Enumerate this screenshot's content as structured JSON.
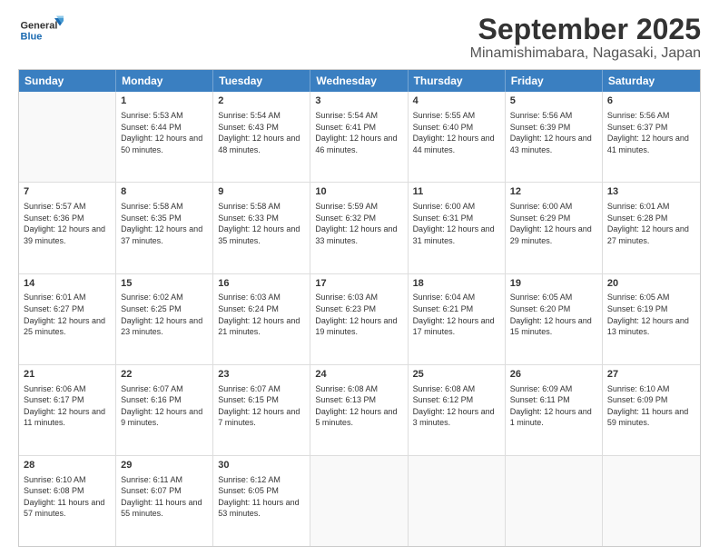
{
  "logo": {
    "general": "General",
    "blue": "Blue"
  },
  "title": "September 2025",
  "subtitle": "Minamishimabara, Nagasaki, Japan",
  "days": [
    "Sunday",
    "Monday",
    "Tuesday",
    "Wednesday",
    "Thursday",
    "Friday",
    "Saturday"
  ],
  "rows": [
    [
      {
        "day": "",
        "empty": true
      },
      {
        "day": "1",
        "sunrise": "Sunrise: 5:53 AM",
        "sunset": "Sunset: 6:44 PM",
        "daylight": "Daylight: 12 hours and 50 minutes."
      },
      {
        "day": "2",
        "sunrise": "Sunrise: 5:54 AM",
        "sunset": "Sunset: 6:43 PM",
        "daylight": "Daylight: 12 hours and 48 minutes."
      },
      {
        "day": "3",
        "sunrise": "Sunrise: 5:54 AM",
        "sunset": "Sunset: 6:41 PM",
        "daylight": "Daylight: 12 hours and 46 minutes."
      },
      {
        "day": "4",
        "sunrise": "Sunrise: 5:55 AM",
        "sunset": "Sunset: 6:40 PM",
        "daylight": "Daylight: 12 hours and 44 minutes."
      },
      {
        "day": "5",
        "sunrise": "Sunrise: 5:56 AM",
        "sunset": "Sunset: 6:39 PM",
        "daylight": "Daylight: 12 hours and 43 minutes."
      },
      {
        "day": "6",
        "sunrise": "Sunrise: 5:56 AM",
        "sunset": "Sunset: 6:37 PM",
        "daylight": "Daylight: 12 hours and 41 minutes."
      }
    ],
    [
      {
        "day": "7",
        "sunrise": "Sunrise: 5:57 AM",
        "sunset": "Sunset: 6:36 PM",
        "daylight": "Daylight: 12 hours and 39 minutes."
      },
      {
        "day": "8",
        "sunrise": "Sunrise: 5:58 AM",
        "sunset": "Sunset: 6:35 PM",
        "daylight": "Daylight: 12 hours and 37 minutes."
      },
      {
        "day": "9",
        "sunrise": "Sunrise: 5:58 AM",
        "sunset": "Sunset: 6:33 PM",
        "daylight": "Daylight: 12 hours and 35 minutes."
      },
      {
        "day": "10",
        "sunrise": "Sunrise: 5:59 AM",
        "sunset": "Sunset: 6:32 PM",
        "daylight": "Daylight: 12 hours and 33 minutes."
      },
      {
        "day": "11",
        "sunrise": "Sunrise: 6:00 AM",
        "sunset": "Sunset: 6:31 PM",
        "daylight": "Daylight: 12 hours and 31 minutes."
      },
      {
        "day": "12",
        "sunrise": "Sunrise: 6:00 AM",
        "sunset": "Sunset: 6:29 PM",
        "daylight": "Daylight: 12 hours and 29 minutes."
      },
      {
        "day": "13",
        "sunrise": "Sunrise: 6:01 AM",
        "sunset": "Sunset: 6:28 PM",
        "daylight": "Daylight: 12 hours and 27 minutes."
      }
    ],
    [
      {
        "day": "14",
        "sunrise": "Sunrise: 6:01 AM",
        "sunset": "Sunset: 6:27 PM",
        "daylight": "Daylight: 12 hours and 25 minutes."
      },
      {
        "day": "15",
        "sunrise": "Sunrise: 6:02 AM",
        "sunset": "Sunset: 6:25 PM",
        "daylight": "Daylight: 12 hours and 23 minutes."
      },
      {
        "day": "16",
        "sunrise": "Sunrise: 6:03 AM",
        "sunset": "Sunset: 6:24 PM",
        "daylight": "Daylight: 12 hours and 21 minutes."
      },
      {
        "day": "17",
        "sunrise": "Sunrise: 6:03 AM",
        "sunset": "Sunset: 6:23 PM",
        "daylight": "Daylight: 12 hours and 19 minutes."
      },
      {
        "day": "18",
        "sunrise": "Sunrise: 6:04 AM",
        "sunset": "Sunset: 6:21 PM",
        "daylight": "Daylight: 12 hours and 17 minutes."
      },
      {
        "day": "19",
        "sunrise": "Sunrise: 6:05 AM",
        "sunset": "Sunset: 6:20 PM",
        "daylight": "Daylight: 12 hours and 15 minutes."
      },
      {
        "day": "20",
        "sunrise": "Sunrise: 6:05 AM",
        "sunset": "Sunset: 6:19 PM",
        "daylight": "Daylight: 12 hours and 13 minutes."
      }
    ],
    [
      {
        "day": "21",
        "sunrise": "Sunrise: 6:06 AM",
        "sunset": "Sunset: 6:17 PM",
        "daylight": "Daylight: 12 hours and 11 minutes."
      },
      {
        "day": "22",
        "sunrise": "Sunrise: 6:07 AM",
        "sunset": "Sunset: 6:16 PM",
        "daylight": "Daylight: 12 hours and 9 minutes."
      },
      {
        "day": "23",
        "sunrise": "Sunrise: 6:07 AM",
        "sunset": "Sunset: 6:15 PM",
        "daylight": "Daylight: 12 hours and 7 minutes."
      },
      {
        "day": "24",
        "sunrise": "Sunrise: 6:08 AM",
        "sunset": "Sunset: 6:13 PM",
        "daylight": "Daylight: 12 hours and 5 minutes."
      },
      {
        "day": "25",
        "sunrise": "Sunrise: 6:08 AM",
        "sunset": "Sunset: 6:12 PM",
        "daylight": "Daylight: 12 hours and 3 minutes."
      },
      {
        "day": "26",
        "sunrise": "Sunrise: 6:09 AM",
        "sunset": "Sunset: 6:11 PM",
        "daylight": "Daylight: 12 hours and 1 minute."
      },
      {
        "day": "27",
        "sunrise": "Sunrise: 6:10 AM",
        "sunset": "Sunset: 6:09 PM",
        "daylight": "Daylight: 11 hours and 59 minutes."
      }
    ],
    [
      {
        "day": "28",
        "sunrise": "Sunrise: 6:10 AM",
        "sunset": "Sunset: 6:08 PM",
        "daylight": "Daylight: 11 hours and 57 minutes."
      },
      {
        "day": "29",
        "sunrise": "Sunrise: 6:11 AM",
        "sunset": "Sunset: 6:07 PM",
        "daylight": "Daylight: 11 hours and 55 minutes."
      },
      {
        "day": "30",
        "sunrise": "Sunrise: 6:12 AM",
        "sunset": "Sunset: 6:05 PM",
        "daylight": "Daylight: 11 hours and 53 minutes."
      },
      {
        "day": "",
        "empty": true
      },
      {
        "day": "",
        "empty": true
      },
      {
        "day": "",
        "empty": true
      },
      {
        "day": "",
        "empty": true
      }
    ]
  ]
}
